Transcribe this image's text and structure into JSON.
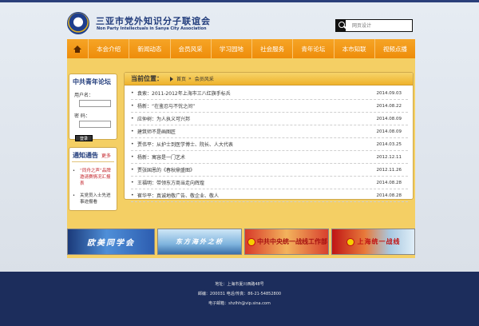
{
  "header": {
    "title": "三亚市党外知识分子联谊会",
    "subtitle": "Non Party Intellectuals in Sanya City Association",
    "search_placeholder": "网页设计"
  },
  "nav": {
    "home_icon": "home-icon",
    "items": [
      "本会介绍",
      "新闻动态",
      "会员风采",
      "学习园地",
      "社会服务",
      "青年论坛",
      "本市知联",
      "视频点播"
    ]
  },
  "forum": {
    "title": "中共青年论坛",
    "username_label": "用户名：",
    "password_label": "密  码：",
    "login_label": "登录"
  },
  "notice": {
    "title": "通知通告",
    "more": "更多",
    "items": [
      {
        "text": "“同舟之声”品牌邀请赛情况汇报表",
        "color": "#c3232a"
      },
      {
        "text": "关党员入士先进事迹报看",
        "color": "#333333"
      }
    ]
  },
  "main": {
    "location_label": "当前位置：",
    "breadcrumb": [
      "首页",
      "会员风采"
    ],
    "news": [
      {
        "title": "袁索：2011-2012年上海市三八红旗手标兵",
        "date": "2014.09.03"
      },
      {
        "title": "杨新：“在鉴忍与不忧之间”",
        "date": "2014.08.22"
      },
      {
        "title": "应仲树：为人执义可兴邦",
        "date": "2014.08.09"
      },
      {
        "title": "建筑师不是画图匠",
        "date": "2014.08.09"
      },
      {
        "title": "贾伟平：从护士到医学博士、院长、人大代表",
        "date": "2014.03.25"
      },
      {
        "title": "杨新：寓容是一门艺术",
        "date": "2012.12.11"
      },
      {
        "title": "贾张国恩的《春秋鼎盛图》",
        "date": "2012.11.26"
      },
      {
        "title": "王福明：带领东方商当走向辉煌",
        "date": "2014.08.28"
      },
      {
        "title": "崔华平：真诚地敬广告、敬企业、敬人",
        "date": "2014.08.28"
      }
    ]
  },
  "banners": [
    {
      "text": "欧美同学会"
    },
    {
      "text": "东方海外之桥"
    },
    {
      "text": "中共中央统一战线工作部"
    },
    {
      "text": "上海统一战线"
    }
  ],
  "footer": {
    "address": "地址：上海市夏川西路48号",
    "contact": "邮编：200031  电话/传真：86-21-54852800",
    "email": "电子邮箱：shzlhh@vip.sina.com"
  },
  "colors": {
    "nav_orange": "#f29a1a",
    "content_yellow": "#f4cf64",
    "footer_navy": "#1c2d5c",
    "title_blue": "#1f3a7a"
  }
}
